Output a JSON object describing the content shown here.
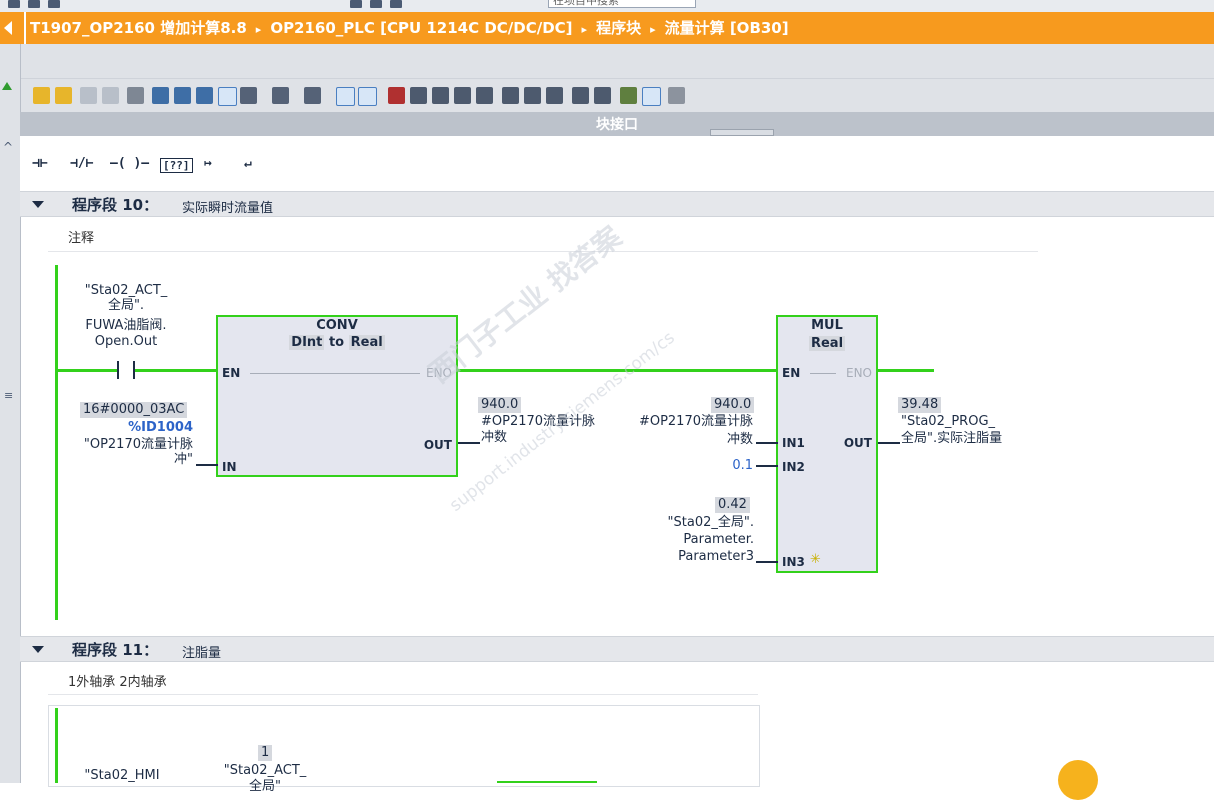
{
  "top": {
    "search_placeholder": "在项目中搜索"
  },
  "breadcrumb": {
    "items": [
      "T1907_OP2160 增加计算8.8",
      "OP2160_PLC [CPU 1214C DC/DC/DC]",
      "程序块",
      "流量计算 [OB30]"
    ],
    "separator": "▸"
  },
  "interface_bar": {
    "label": "块接口"
  },
  "ladder_toolbar": {
    "items": [
      "⊣⊢",
      "⊣/⊢",
      "–( )–",
      "[??]",
      "↦",
      "↵"
    ]
  },
  "network10": {
    "title": "程序段 10：",
    "subtitle": "实际瞬时流量值",
    "comment": "注释",
    "contact": {
      "lines": [
        "\"Sta02_ACT_",
        "全局\".",
        "FUWA油脂阀.",
        "Open.Out"
      ]
    },
    "conv": {
      "title": "CONV",
      "types": {
        "from": "DInt",
        "to_word": "to",
        "to": "Real"
      },
      "en": "EN",
      "eno": "ENO",
      "in": "IN",
      "out": "OUT",
      "in_value": "16#0000_03AC",
      "in_address": "%ID1004",
      "in_tag": [
        "\"OP2170流量计脉",
        "冲\""
      ],
      "out_value": "940.0",
      "out_tag": [
        "#OP2170流量计脉",
        "冲数"
      ]
    },
    "mul": {
      "title": "MUL",
      "type": "Real",
      "en": "EN",
      "eno": "ENO",
      "in1": "IN1",
      "in2": "IN2",
      "in3": "IN3",
      "out": "OUT",
      "in1_value": "940.0",
      "in1_tag": [
        "#OP2170流量计脉",
        "冲数"
      ],
      "in2_value": "0.1",
      "in3_value": "0.42",
      "in3_tag": [
        "\"Sta02_全局\".",
        "Parameter.",
        "Parameter3"
      ],
      "out_value": "39.48",
      "out_tag": [
        "\"Sta02_PROG_",
        "全局\".实际注脂量"
      ]
    }
  },
  "network11": {
    "title": "程序段 11：",
    "subtitle": "注脂量",
    "comment": "1外轴承 2内轴承",
    "partial": {
      "value": "1",
      "tag_left": "\"Sta02_HMI",
      "tag_right": [
        "\"Sta02_ACT_",
        "全局\""
      ]
    }
  },
  "watermark": {
    "text": "西门子工业  找答案",
    "url": "support.industry.siemens.com/cs"
  },
  "colors": {
    "accent": "#f79a1e",
    "wire": "#33d11b",
    "box": "#e4e6ef"
  }
}
